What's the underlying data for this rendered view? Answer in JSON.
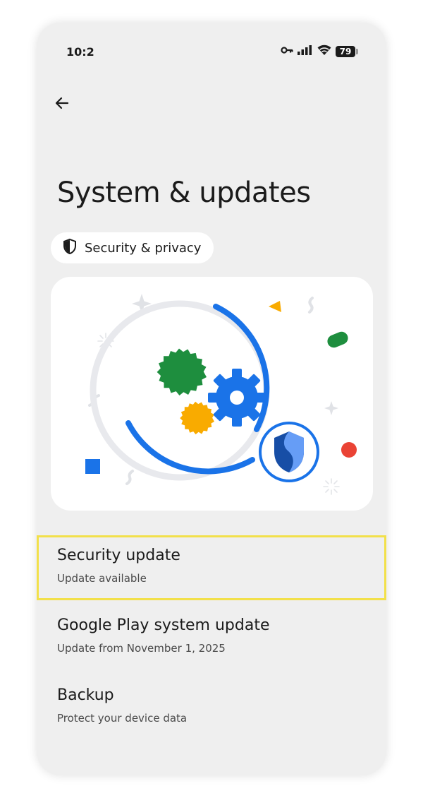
{
  "status_bar": {
    "time": "10:2",
    "battery_level": "79",
    "icons": [
      "key-icon",
      "signal-icon",
      "wifi-icon",
      "battery-icon"
    ]
  },
  "header": {
    "back_icon": "arrow-back-icon",
    "title": "System & updates"
  },
  "chip": {
    "icon": "shield-icon",
    "label": "Security & privacy"
  },
  "colors": {
    "phone_bg": "#efefef",
    "card_bg": "#ffffff",
    "blue": "#1a73e8",
    "green": "#1e8e3e",
    "yellow": "#f9ab00",
    "red": "#ea4335",
    "highlight": "#f2e04a"
  },
  "list": [
    {
      "title": "Security update",
      "subtitle": "Update available",
      "highlighted": true
    },
    {
      "title": "Google Play system update",
      "subtitle": "Update from November 1, 2025"
    },
    {
      "title": "Backup",
      "subtitle": "Protect your device data"
    }
  ]
}
